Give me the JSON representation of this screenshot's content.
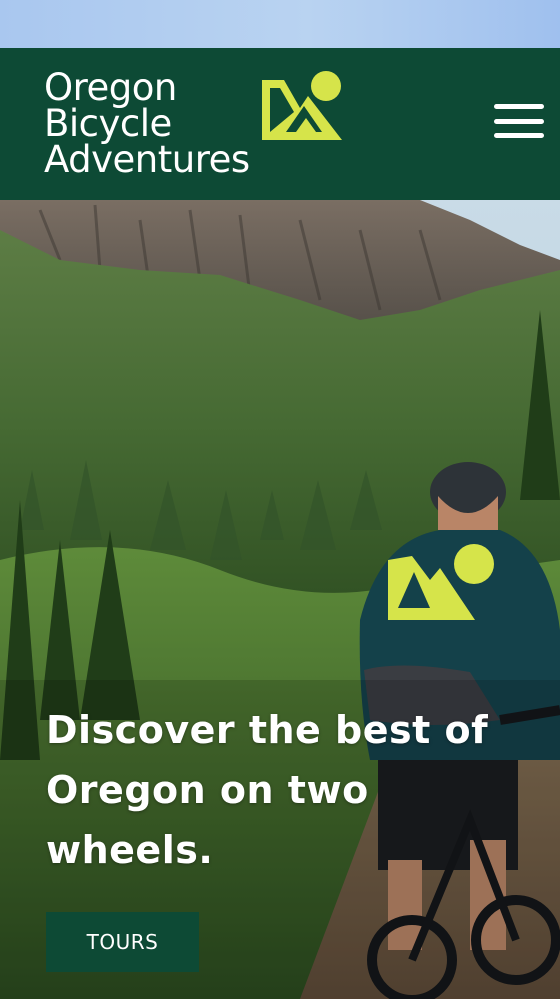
{
  "brand": {
    "line1": "Oregon",
    "line2": "Bicycle",
    "line3": "Adventures",
    "logo_icon": "mountain-sun-icon",
    "accent_color": "#d6e44a",
    "header_color": "#0d4a35"
  },
  "header": {
    "menu_icon": "hamburger-menu-icon"
  },
  "hero": {
    "headline": "Discover the best of Oregon on two wheels.",
    "cta_label": "TOURS"
  }
}
